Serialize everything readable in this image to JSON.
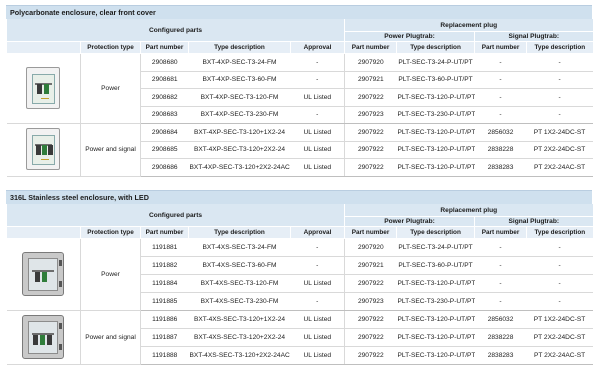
{
  "section1": {
    "title": "Polycarbonate enclosure, clear front cover",
    "configured_parts": "Configured parts",
    "replacement_plug": "Replacement plug",
    "power_plugtrab": "Power Plugtrab:",
    "signal_plugtrab": "Signal Plugtrab:",
    "columns": [
      "Protection type",
      "Part number",
      "Type description",
      "Approval",
      "Part number",
      "Type description",
      "Part number",
      "Type description"
    ],
    "groups": [
      {
        "protection_type": "Power",
        "rows": [
          [
            "2908680",
            "BXT-4XP-SEC-T3-24-FM",
            "-",
            "2907920",
            "PLT-SEC-T3-24-P-UT/PT",
            "-",
            "-"
          ],
          [
            "2908681",
            "BXT-4XP-SEC-T3-60-FM",
            "-",
            "2907921",
            "PLT-SEC-T3-60-P-UT/PT",
            "-",
            "-"
          ],
          [
            "2908682",
            "BXT-4XP-SEC-T3-120-FM",
            "UL Listed",
            "2907922",
            "PLT-SEC-T3-120-P-UT/PT",
            "-",
            "-"
          ],
          [
            "2908683",
            "BXT-4XP-SEC-T3-230-FM",
            "-",
            "2907923",
            "PLT-SEC-T3-230-P-UT/PT",
            "-",
            "-"
          ]
        ]
      },
      {
        "protection_type": "Power and signal",
        "rows": [
          [
            "2908684",
            "BXT-4XP-SEC-T3-120+1X2-24",
            "UL Listed",
            "2907922",
            "PLT-SEC-T3-120-P-UT/PT",
            "2856032",
            "PT 1X2-24DC-ST"
          ],
          [
            "2908685",
            "BXT-4XP-SEC-T3-120+2X2-24",
            "UL Listed",
            "2907922",
            "PLT-SEC-T3-120-P-UT/PT",
            "2838228",
            "PT 2X2-24DC-ST"
          ],
          [
            "2908686",
            "BXT-4XP-SEC-T3-120+2X2-24AC",
            "UL Listed",
            "2907922",
            "PLT-SEC-T3-120-P-UT/PT",
            "2838283",
            "PT 2X2-24AC-ST"
          ]
        ]
      }
    ]
  },
  "section2": {
    "title": "316L Stainless steel enclosure, with LED",
    "configured_parts": "Configured parts",
    "replacement_plug": "Replacement plug",
    "power_plugtrab": "Power Plugtrab:",
    "signal_plugtrab": "Signal Plugtrab:",
    "columns": [
      "Protection type",
      "Part number",
      "Type description",
      "Approval",
      "Part number",
      "Type description",
      "Part number",
      "Type description"
    ],
    "groups": [
      {
        "protection_type": "Power",
        "rows": [
          [
            "1191881",
            "BXT-4XS-SEC-T3-24-FM",
            "-",
            "2907920",
            "PLT-SEC-T3-24-P-UT/PT",
            "-",
            "-"
          ],
          [
            "1191882",
            "BXT-4XS-SEC-T3-60-FM",
            "-",
            "2907921",
            "PLT-SEC-T3-60-P-UT/PT",
            "-",
            "-"
          ],
          [
            "1191884",
            "BXT-4XS-SEC-T3-120-FM",
            "UL Listed",
            "2907922",
            "PLT-SEC-T3-120-P-UT/PT",
            "-",
            "-"
          ],
          [
            "1191885",
            "BXT-4XS-SEC-T3-230-FM",
            "-",
            "2907923",
            "PLT-SEC-T3-230-P-UT/PT",
            "-",
            "-"
          ]
        ]
      },
      {
        "protection_type": "Power and signal",
        "rows": [
          [
            "1191886",
            "BXT-4XS-SEC-T3-120+1X2-24",
            "UL Listed",
            "2907922",
            "PLT-SEC-T3-120-P-UT/PT",
            "2856032",
            "PT 1X2-24DC-ST"
          ],
          [
            "1191887",
            "BXT-4XS-SEC-T3-120+2X2-24",
            "UL Listed",
            "2907922",
            "PLT-SEC-T3-120-P-UT/PT",
            "2838228",
            "PT 2X2-24DC-ST"
          ],
          [
            "1191888",
            "BXT-4XS-SEC-T3-120+2X2-24AC",
            "UL Listed",
            "2907922",
            "PLT-SEC-T3-120-P-UT/PT",
            "2838283",
            "PT 2X2-24AC-ST"
          ]
        ]
      }
    ]
  }
}
